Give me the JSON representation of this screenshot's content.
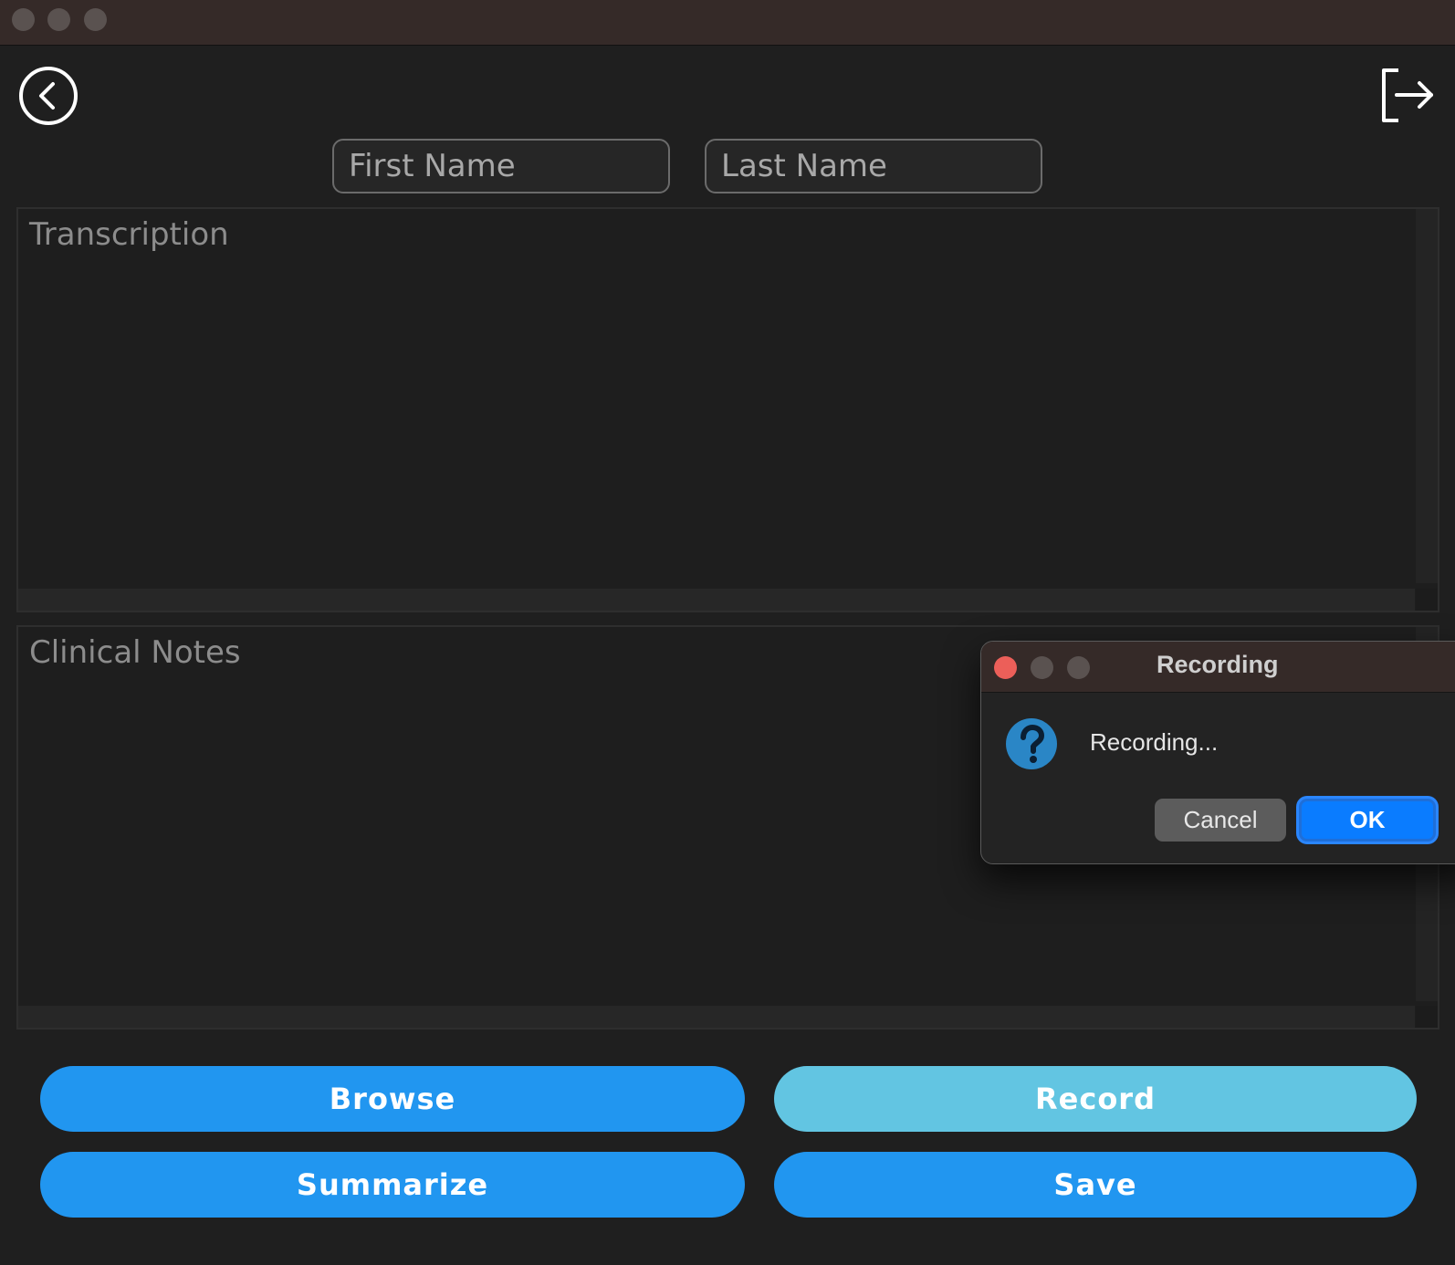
{
  "window": {
    "traffic_lights": [
      "close",
      "minimize",
      "zoom"
    ]
  },
  "header": {
    "back_icon": "chevron-left-circle-icon",
    "logout_icon": "logout-arrow-icon"
  },
  "form": {
    "first_name": {
      "placeholder": "First Name",
      "value": ""
    },
    "last_name": {
      "placeholder": "Last Name",
      "value": ""
    },
    "transcription": {
      "placeholder": "Transcription",
      "value": ""
    },
    "clinical_notes": {
      "placeholder": "Clinical Notes",
      "value": ""
    }
  },
  "actions": {
    "browse": "Browse",
    "record": "Record",
    "summarize": "Summarize",
    "save": "Save"
  },
  "dialog": {
    "title": "Recording",
    "message": "Recording...",
    "icon": "question-icon",
    "cancel_label": "Cancel",
    "ok_label": "OK"
  },
  "colors": {
    "accent": "#2196f0",
    "record_active": "#62c5e2",
    "ok_button": "#0a7cff",
    "close_light": "#ec5f59"
  }
}
